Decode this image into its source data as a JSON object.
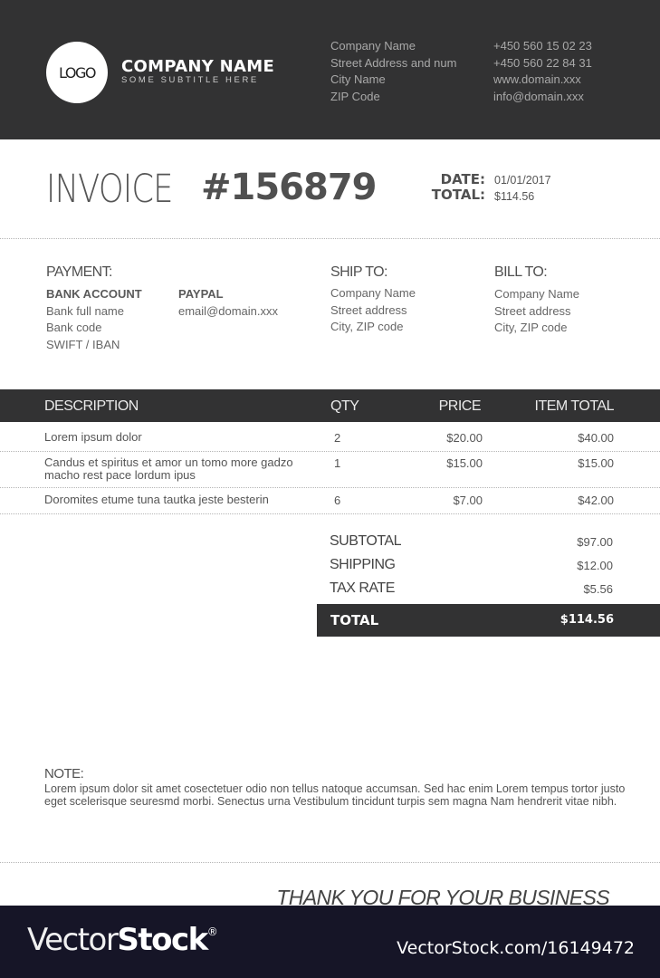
{
  "header": {
    "logo_text": "LOGO",
    "company_name": "COMPANY NAME",
    "company_subtitle": "SOME SUBTITLE HERE",
    "address": [
      "Company Name",
      "Street Address and num",
      "City Name",
      "ZIP Code"
    ],
    "contact": [
      "+450 560 15 02 23",
      "+450 560 22 84 31",
      "www.domain.xxx",
      "info@domain.xxx"
    ]
  },
  "invoice": {
    "title": "INVOICE",
    "number": "#156879",
    "date_label": "DATE:",
    "date_value": "01/01/2017",
    "total_label": "TOTAL:",
    "total_value": "$114.56"
  },
  "payment": {
    "title": "PAYMENT:",
    "bank": {
      "heading": "BANK ACCOUNT",
      "lines": [
        "Bank full name",
        "Bank code",
        "SWIFT / IBAN"
      ]
    },
    "paypal": {
      "heading": "PAYPAL",
      "lines": [
        "email@domain.xxx"
      ]
    }
  },
  "ship_to": {
    "title": "SHIP TO:",
    "lines": [
      "Company Name",
      "Street address",
      "City, ZIP code"
    ]
  },
  "bill_to": {
    "title": "BILL TO:",
    "lines": [
      "Company Name",
      "Street address",
      "City, ZIP code"
    ]
  },
  "table": {
    "headers": {
      "description": "DESCRIPTION",
      "qty": "QTY",
      "price": "PRICE",
      "item_total": "ITEM TOTAL"
    },
    "rows": [
      {
        "description": "Lorem ipsum dolor",
        "qty": "2",
        "price": "$20.00",
        "item_total": "$40.00"
      },
      {
        "description": "Candus et spiritus et amor un tomo more gadzo macho rest pace lordum ipus",
        "qty": "1",
        "price": "$15.00",
        "item_total": "$15.00"
      },
      {
        "description": "Doromites etume tuna tautka jeste besterin",
        "qty": "6",
        "price": "$7.00",
        "item_total": "$42.00"
      }
    ]
  },
  "summary": {
    "subtotal_label": "SUBTOTAL",
    "subtotal_value": "$97.00",
    "shipping_label": "SHIPPING",
    "shipping_value": "$12.00",
    "tax_label": "TAX RATE",
    "tax_value": "$5.56",
    "total_label": "TOTAL",
    "total_value": "$114.56"
  },
  "note": {
    "title": "NOTE:",
    "text": "Lorem ipsum dolor sit amet cosectetuer odio non tellus natoque accumsan. Sed hac enim Lorem tempus tortor justo eget scelerisque seuresmd morbi. Senectus urna Vestibulum tincidunt turpis sem magna Nam hendrerit vitae nibh."
  },
  "thanks": "THANK YOU FOR YOUR BUSINESS",
  "watermark": {
    "brand_thin": "Vector",
    "brand_bold": "Stock",
    "registered": "®",
    "url": "VectorStock.com/16149472"
  },
  "colors": {
    "dark_band": "#323233",
    "footer": "#161527",
    "text": "#555555"
  }
}
